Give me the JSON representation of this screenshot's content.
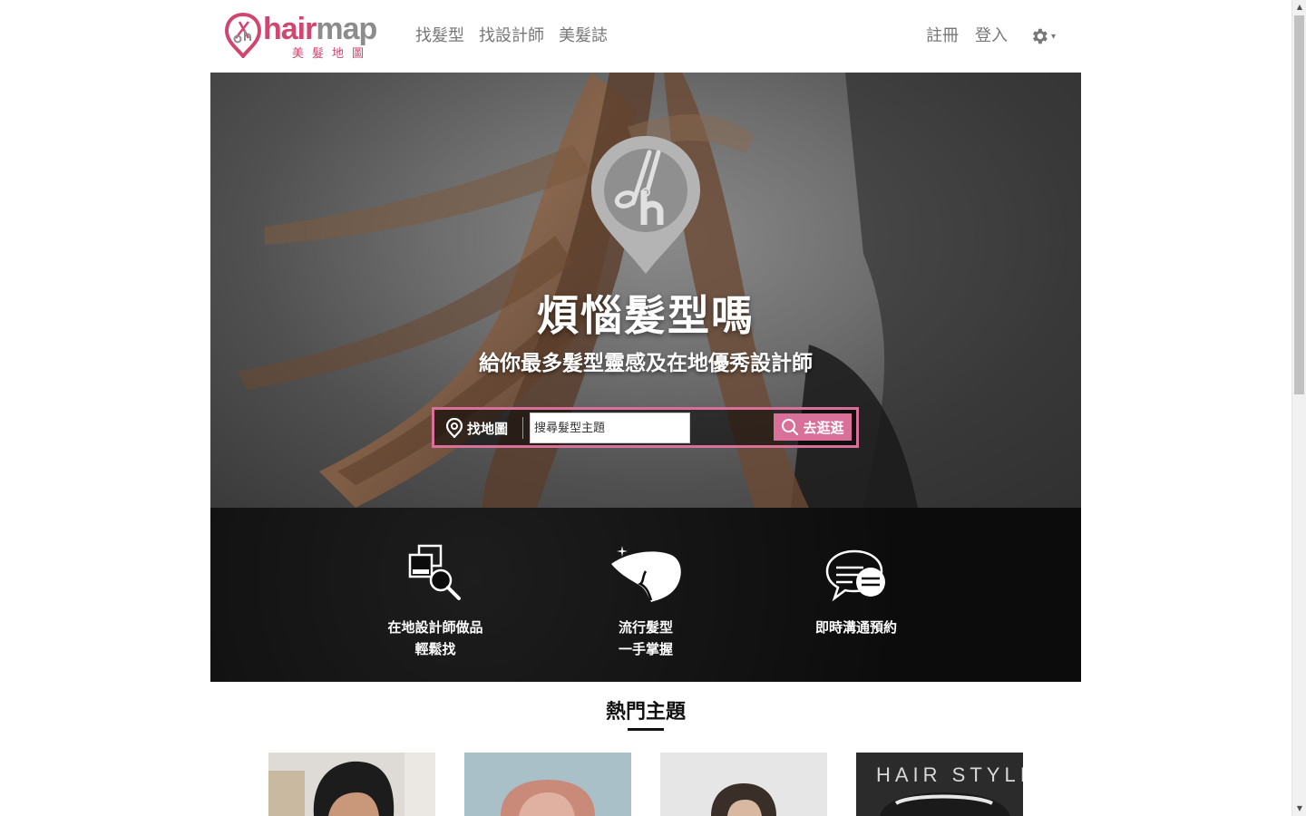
{
  "nav": {
    "logo_word_hair": "hair",
    "logo_word_map": "map",
    "logo_sub": "美髮地圖",
    "links": [
      "找髮型",
      "找設計師",
      "美髮誌"
    ],
    "register": "註冊",
    "login": "登入",
    "settings_icon": "gear-icon",
    "settings_caret": "▾"
  },
  "hero": {
    "title": "煩惱髮型嗎",
    "subtitle": "給你最多髮型靈感及在地優秀設計師",
    "map_button": "找地圖",
    "search_placeholder": "搜尋髮型主題",
    "search_button": "去逛逛"
  },
  "features": [
    {
      "icon": "portfolio-search-icon",
      "line1": "在地設計師做品",
      "line2": "輕鬆找"
    },
    {
      "icon": "hairstyle-silhouette-icon",
      "line1": "流行髮型",
      "line2": "一手掌握"
    },
    {
      "icon": "chat-bubbles-icon",
      "line1": "即時溝通預約",
      "line2": ""
    }
  ],
  "topics": {
    "title": "熱門主題",
    "thumb_text": "HAIR STYLIS"
  },
  "colors": {
    "brand_pink": "#d1466f",
    "button_pink": "#d8709a",
    "nav_text": "#777777"
  }
}
